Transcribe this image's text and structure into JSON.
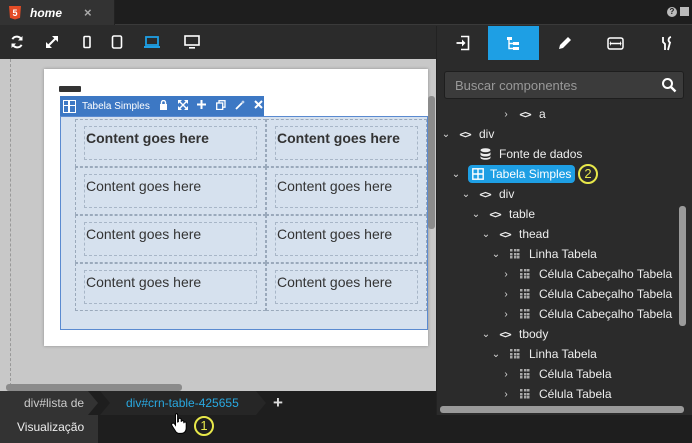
{
  "tab": {
    "badge": "5",
    "title": "home",
    "close": "×"
  },
  "window": {
    "help": "?"
  },
  "component_toolbar": {
    "label": "Tabela Simples",
    "icons": [
      "lock-icon",
      "move-icon",
      "add-icon",
      "copy-icon",
      "magic-wand-icon",
      "close-icon"
    ]
  },
  "table": {
    "header": [
      "Content goes here",
      "Content goes here"
    ],
    "rows": [
      [
        "Content goes here",
        "Content goes here"
      ],
      [
        "Content goes here",
        "Content goes here"
      ],
      [
        "Content goes here",
        "Content goes here"
      ]
    ]
  },
  "breadcrumbs": [
    "div#lista de",
    "div#crn-table-425655"
  ],
  "breadcrumb_add": "+",
  "status": {
    "view_tab": "Visualização"
  },
  "search": {
    "placeholder": "Buscar componentes"
  },
  "tree": [
    {
      "label": "a",
      "icon": "tag-icon",
      "arrow": "›"
    },
    {
      "label": "div",
      "icon": "tag-icon",
      "arrow": "⌄"
    },
    {
      "label": "Fonte de dados",
      "icon": "database-icon",
      "arrow": ""
    },
    {
      "label": "Tabela Simples",
      "icon": "table-icon",
      "arrow": "⌄",
      "selected": true
    },
    {
      "label": "div",
      "icon": "tag-icon",
      "arrow": "⌄"
    },
    {
      "label": "table",
      "icon": "tag-icon",
      "arrow": "⌄"
    },
    {
      "label": "thead",
      "icon": "tag-icon",
      "arrow": "⌄"
    },
    {
      "label": "Linha Tabela",
      "icon": "grid-icon",
      "arrow": "⌄"
    },
    {
      "label": "Célula Cabeçalho Tabela",
      "icon": "grid-icon",
      "arrow": "›"
    },
    {
      "label": "Célula Cabeçalho Tabela",
      "icon": "grid-icon",
      "arrow": "›"
    },
    {
      "label": "Célula Cabeçalho Tabela",
      "icon": "grid-icon",
      "arrow": "›"
    },
    {
      "label": "tbody",
      "icon": "tag-icon",
      "arrow": "⌄"
    },
    {
      "label": "Linha Tabela",
      "icon": "grid-icon",
      "arrow": "⌄"
    },
    {
      "label": "Célula Tabela",
      "icon": "grid-icon",
      "arrow": "›"
    },
    {
      "label": "Célula Tabela",
      "icon": "grid-icon",
      "arrow": "›"
    }
  ],
  "annotations": {
    "marker_1": "1",
    "marker_2": "2"
  },
  "colors": {
    "accent": "#1e9fe4",
    "component_blue": "#3d78c4",
    "annotation": "#e8e84a"
  }
}
